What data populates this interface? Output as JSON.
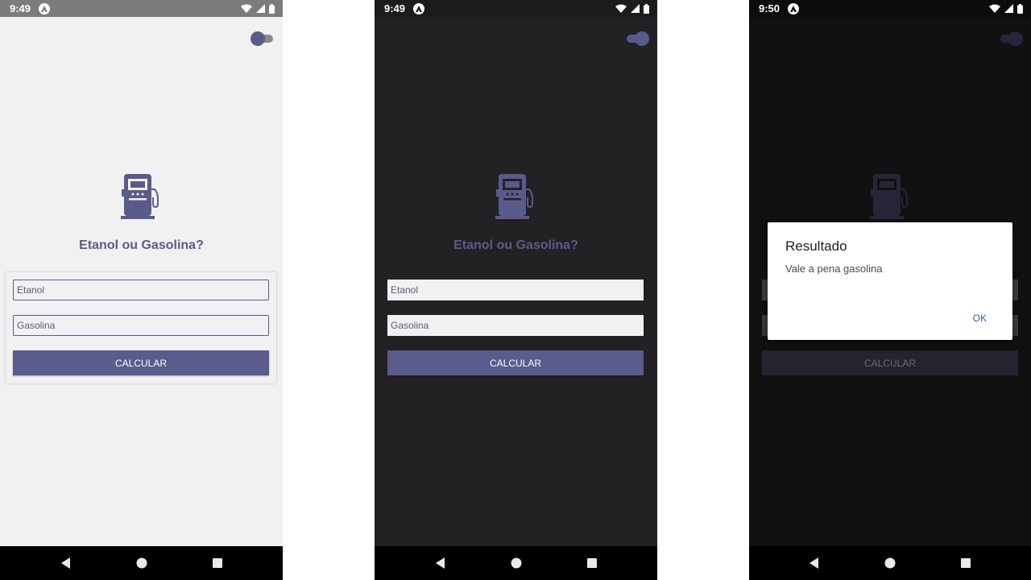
{
  "screens": [
    {
      "time": "9:49",
      "theme": "light"
    },
    {
      "time": "9:49",
      "theme": "dark"
    },
    {
      "time": "9:50",
      "theme": "dark-dialog"
    }
  ],
  "app": {
    "title": "Etanol ou Gasolina?",
    "etanol_placeholder": "Etanol",
    "gasolina_placeholder": "Gasolina",
    "calculate_label": "CALCULAR"
  },
  "dialog": {
    "title": "Resultado",
    "message": "Vale a pena gasolina",
    "ok_label": "OK"
  },
  "colors": {
    "accent": "#5a5a8c",
    "light_bg": "#f1f1f1",
    "dark_bg": "#242124"
  },
  "icons": {
    "main": "fuel-pump-icon",
    "status": [
      "wifi-icon",
      "signal-icon",
      "battery-icon"
    ],
    "nav": [
      "back-icon",
      "home-icon",
      "recents-icon"
    ]
  }
}
